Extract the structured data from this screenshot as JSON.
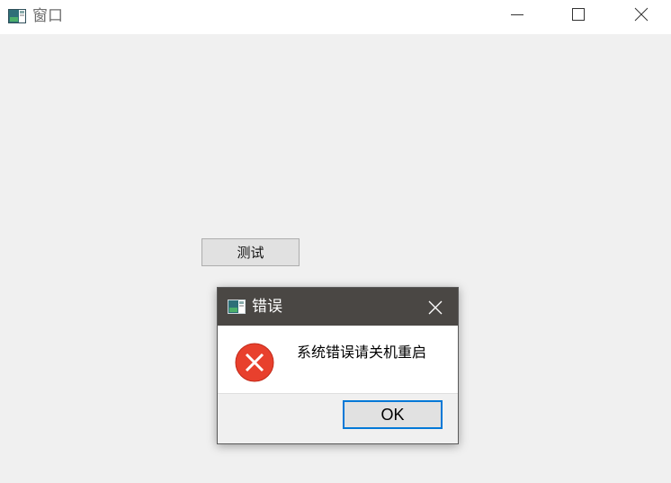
{
  "window": {
    "title": "窗口",
    "icon": "app-window-icon"
  },
  "controls": {
    "minimize_icon": "minimize-icon",
    "maximize_icon": "maximize-icon",
    "close_icon": "close-icon"
  },
  "main": {
    "test_button_label": "测试"
  },
  "dialog": {
    "title": "错误",
    "icon": "app-window-icon",
    "close_icon": "close-icon",
    "error_icon": "error-icon",
    "message": "系统错误请关机重启",
    "ok_label": "OK",
    "colors": {
      "titlebar": "#4a4744",
      "error_red": "#e8402d",
      "focus_border": "#0078d7"
    }
  }
}
